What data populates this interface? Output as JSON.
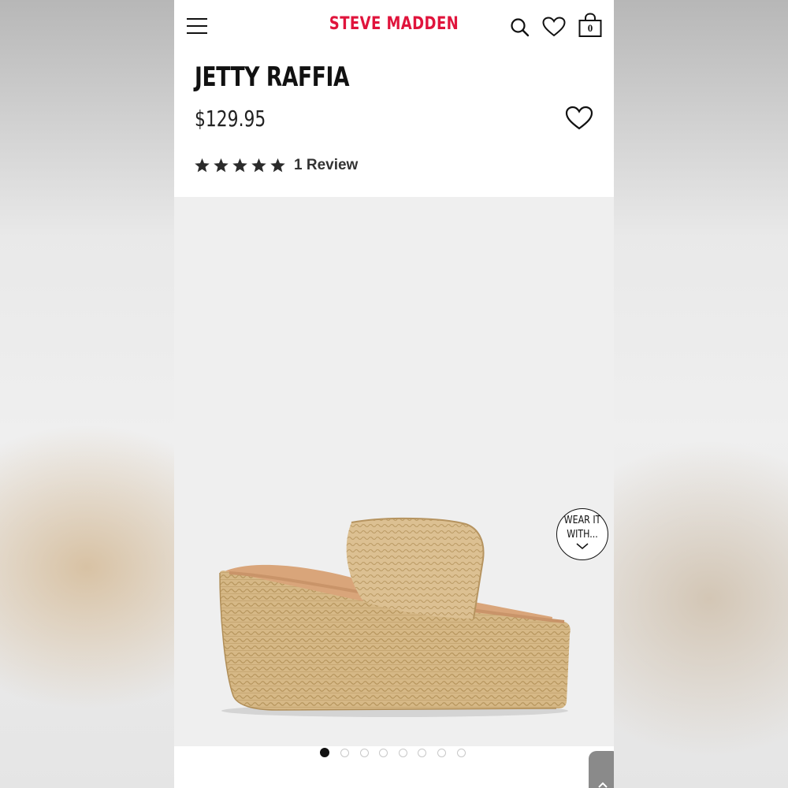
{
  "header": {
    "brand": "STEVE MADDEN",
    "bag_count": "0",
    "icons": [
      "menu-icon",
      "search-icon",
      "heart-icon",
      "bag-icon"
    ]
  },
  "product": {
    "title": "JETTY RAFFIA",
    "price": "$129.95",
    "rating": {
      "stars": 5,
      "max": 5,
      "review_text": "1 Review"
    }
  },
  "gallery": {
    "badge_line1": "WEAR IT",
    "badge_line2": "WITH...",
    "image_count": 8,
    "active_index": 0
  },
  "colors": {
    "brand_red": "#e0143c",
    "text_dark": "#111111",
    "gallery_bg": "#efefef",
    "raffia": "#d6b886"
  }
}
